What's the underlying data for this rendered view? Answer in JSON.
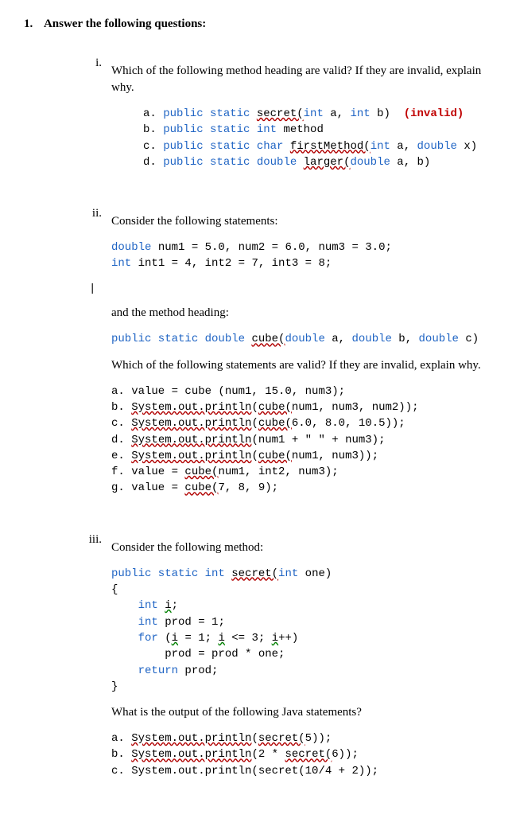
{
  "main": {
    "num": "1.",
    "title": "Answer the following questions:"
  },
  "q1": {
    "num": "i.",
    "prompt": "Which of the following method heading are valid? If they are invalid, explain why.",
    "a_pre": "a. ",
    "a_kw": "public static ",
    "a_sq": "secret(",
    "a_rest": "int",
    "a_rest2": " a, ",
    "a_rest3": "int",
    "a_rest4": " b)  ",
    "a_inv": "(invalid)",
    "b_pre": "b. ",
    "b_kw": "public static int ",
    "b_rest": "method",
    "c_pre": "c. ",
    "c_kw": "public static char ",
    "c_sq": "firstMethod(",
    "c_rest": "int",
    "c_rest2": " a, ",
    "c_rest3": "double",
    "c_rest4": " x)",
    "d_pre": "d. ",
    "d_kw": "public static double ",
    "d_sq": "larger(",
    "d_rest": "double",
    "d_rest2": " a, b)"
  },
  "q2": {
    "num": "ii.",
    "prompt1": "Consider the following statements:",
    "decl_kw1": "double",
    "decl1": " num1 = 5.0, num2 = 6.0, num3 = 3.0;",
    "decl_kw2": "int",
    "decl2": " int1 = 4, int2 = 7, int3 = 8;",
    "cursor": "|",
    "prompt2": "and the method heading:",
    "head_kw": "public static double ",
    "head_sq": "cube(",
    "head_kw2": "double",
    "head_p1": " a, ",
    "head_kw3": "double",
    "head_p2": " b, ",
    "head_kw4": "double",
    "head_p3": " c)",
    "prompt3": "Which of the following statements are valid? If they are invalid, explain why.",
    "a": "a. value = cube (num1, 15.0, num3);",
    "b_pre": "b. ",
    "b_sq": "System.out.println",
    "b_rest1": "(",
    "b_sq2": "cube(",
    "b_rest2": "num1, num3, num2));",
    "c_pre": "c. ",
    "c_sq": "System.out.println",
    "c_rest1": "(",
    "c_sq2": "cube(",
    "c_rest2": "6.0, 8.0, 10.5));",
    "d_pre": "d. ",
    "d_sq": "System.out.println",
    "d_rest": "(num1 + \" \" + num3);",
    "e_pre": "e. ",
    "e_sq": "System.out.println",
    "e_rest1": "(",
    "e_sq2": "cube(",
    "e_rest2": "num1, num3));",
    "f_pre": "f. value = ",
    "f_sq": "cube(",
    "f_rest": "num1, int2, num3);",
    "g_pre": "g. value = ",
    "g_sq": "cube(",
    "g_rest": "7, 8, 9);"
  },
  "q3": {
    "num": "iii.",
    "prompt1": "Consider the following method:",
    "l1_kw": "public static int ",
    "l1_sq": "secret(",
    "l1_kw2": "int",
    "l1_rest": " one)",
    "l2": "{",
    "l3_pre": "    ",
    "l3_kw": "int",
    "l3_sp": " ",
    "l3_sq": "i",
    "l3_rest": ";",
    "l4_pre": "    ",
    "l4_kw": "int",
    "l4_rest": " prod = 1;",
    "l5_pre": "    ",
    "l5_kw": "for",
    "l5_rest1": " (",
    "l5_sq1": "i",
    "l5_rest2": " = 1; ",
    "l5_sq2": "i",
    "l5_rest3": " <= 3; ",
    "l5_sq3": "i",
    "l5_rest4": "++)",
    "l6": "        prod = prod * one;",
    "l7_pre": "    ",
    "l7_kw": "return",
    "l7_rest": " prod;",
    "l8": "}",
    "prompt2": "What is the output of the following Java statements?",
    "a_pre": "a. ",
    "a_sq": "System.out.println",
    "a_rest1": "(",
    "a_sq2": "secret(",
    "a_rest2": "5));",
    "b_pre": "b. ",
    "b_sq": "System.out.println",
    "b_rest1": "(2 * ",
    "b_sq2": "secret(",
    "b_rest2": "6));",
    "c": "c. System.out.println(secret(10/4 + 2));"
  }
}
